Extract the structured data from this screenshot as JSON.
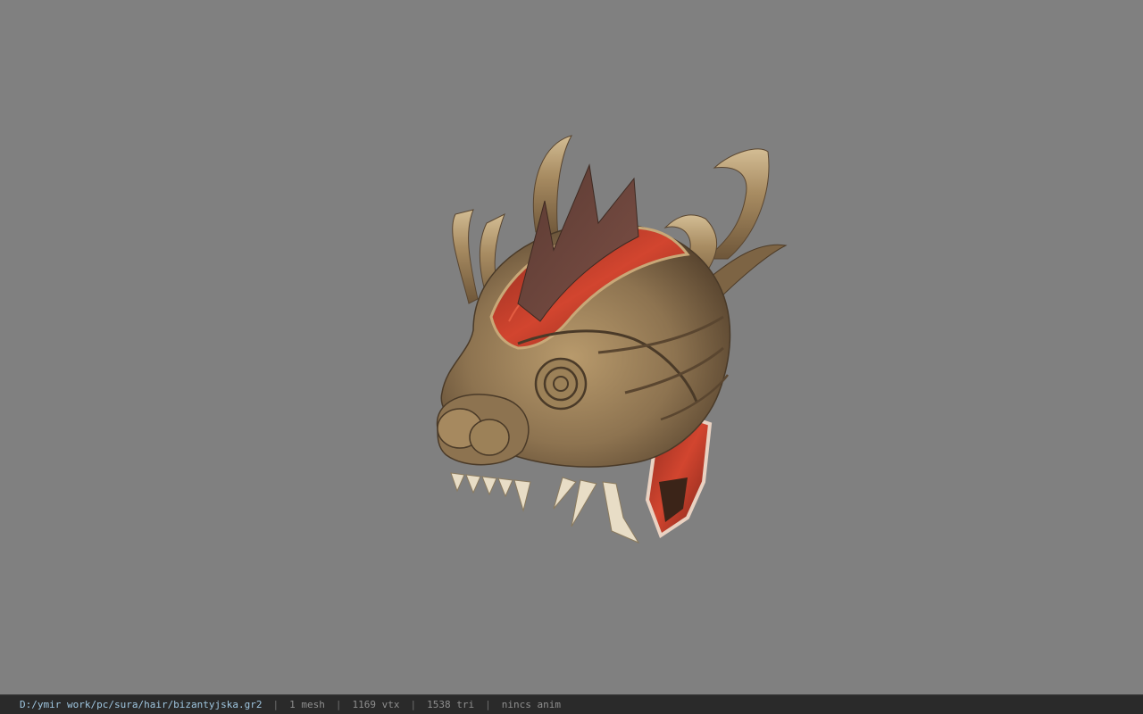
{
  "viewport": {
    "background": "#808080",
    "model_name": "bizantyjska"
  },
  "statusbar": {
    "file_path": "D:/ymir work/pc/sura/hair/bizantyjska.gr2",
    "separator": "|",
    "mesh_count": "1 mesh",
    "vertex_count": "1169 vtx",
    "triangle_count": "1538 tri",
    "anim_status": "nincs anim",
    "path_color": "#9fc6e0"
  }
}
